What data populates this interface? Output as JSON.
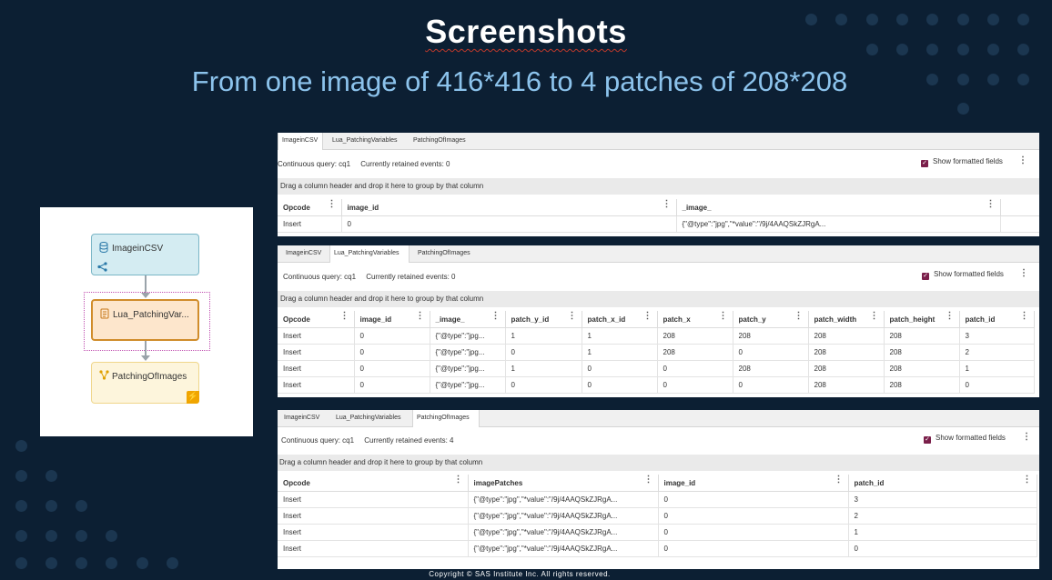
{
  "slide": {
    "title": "Screenshots",
    "subtitle": "From one image of 416*416 to 4 patches of 208*208",
    "footer": "Copyright © SAS Institute Inc. All rights reserved."
  },
  "flow": {
    "nodes": [
      {
        "label": "ImageinCSV",
        "icon": "database-icon"
      },
      {
        "label": "Lua_PatchingVar...",
        "icon": "script-icon"
      },
      {
        "label": "PatchingOfImages",
        "icon": "branch-icon"
      }
    ]
  },
  "tabs": [
    "ImageinCSV",
    "Lua_PatchingVariables",
    "PatchingOfImages"
  ],
  "common": {
    "show_formatted": "Show formatted fields",
    "group_hint": "Drag a column header and drop it here to group by that column",
    "continuous_query": "Continuous query: cq1"
  },
  "panel1": {
    "retained": "Currently retained events: 0",
    "columns": [
      "Opcode",
      "image_id",
      "_image_"
    ],
    "rows": [
      [
        "Insert",
        "0",
        "{\"@type\":\"jpg\",\"*value\":\"/9j/4AAQSkZJRgA..."
      ]
    ]
  },
  "panel2": {
    "retained": "Currently retained events: 0",
    "columns": [
      "Opcode",
      "image_id",
      "_image_",
      "patch_y_id",
      "patch_x_id",
      "patch_x",
      "patch_y",
      "patch_width",
      "patch_height",
      "patch_id"
    ],
    "rows": [
      [
        "Insert",
        "0",
        "{\"@type\":\"jpg...",
        "1",
        "1",
        "208",
        "208",
        "208",
        "208",
        "3"
      ],
      [
        "Insert",
        "0",
        "{\"@type\":\"jpg...",
        "0",
        "1",
        "208",
        "0",
        "208",
        "208",
        "2"
      ],
      [
        "Insert",
        "0",
        "{\"@type\":\"jpg...",
        "1",
        "0",
        "0",
        "208",
        "208",
        "208",
        "1"
      ],
      [
        "Insert",
        "0",
        "{\"@type\":\"jpg...",
        "0",
        "0",
        "0",
        "0",
        "208",
        "208",
        "0"
      ]
    ]
  },
  "panel3": {
    "retained": "Currently retained events: 4",
    "columns": [
      "Opcode",
      "imagePatches",
      "image_id",
      "patch_id"
    ],
    "rows": [
      [
        "Insert",
        "{\"@type\":\"jpg\",\"*value\":\"/9j/4AAQSkZJRgA...",
        "0",
        "3"
      ],
      [
        "Insert",
        "{\"@type\":\"jpg\",\"*value\":\"/9j/4AAQSkZJRgA...",
        "0",
        "2"
      ],
      [
        "Insert",
        "{\"@type\":\"jpg\",\"*value\":\"/9j/4AAQSkZJRgA...",
        "0",
        "1"
      ],
      [
        "Insert",
        "{\"@type\":\"jpg\",\"*value\":\"/9j/4AAQSkZJRgA...",
        "0",
        "0"
      ]
    ]
  }
}
